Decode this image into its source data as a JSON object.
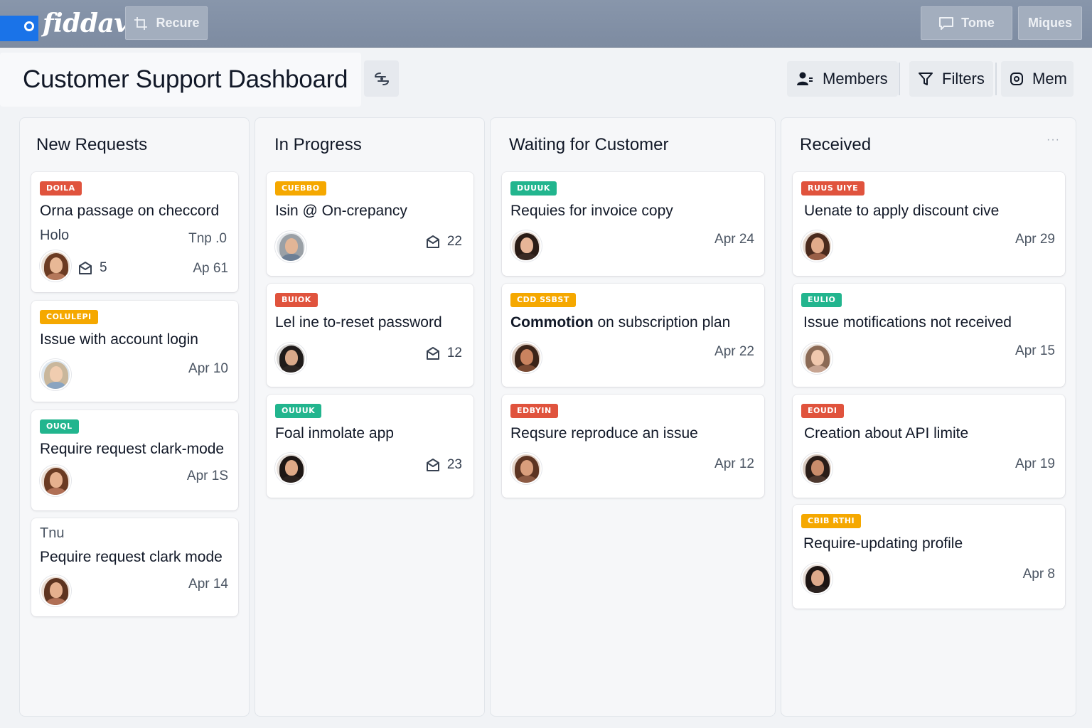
{
  "app": {
    "name": "fiddav",
    "topbar": {
      "left_button": "Recure",
      "right_buttons": [
        "Tome",
        "Miques"
      ]
    }
  },
  "board": {
    "title": "Customer Support Dashboard",
    "actions": [
      "Members",
      "Filters",
      "Mem"
    ]
  },
  "colors": {
    "red": "#e0533d",
    "orange": "#f5a800",
    "green": "#22b58e",
    "topbar": "#8391a6"
  },
  "columns": [
    {
      "title": "New Requests",
      "cards": [
        {
          "tag": "DOILA",
          "tag_color": "red",
          "title": "Orna passage on checcord",
          "sub": "Holo",
          "aux": "Tnp .0",
          "count": "5",
          "date": "Ap 61",
          "avatar": "woman-brown-hair"
        },
        {
          "tag": "COLULEPI",
          "tag_color": "orange",
          "title": "Issue with account login",
          "date": "Apr 10",
          "avatar": "person-light-hair"
        },
        {
          "tag": "OUQL",
          "tag_color": "green",
          "title": "Require request clark-mode",
          "date": "Apr 1S",
          "avatar": "woman-brown-hair"
        },
        {
          "tag": "Tnu",
          "tag_color": "none",
          "title": "Pequire request clark mode",
          "date": "Apr 14",
          "avatar": "woman-brown-hair"
        }
      ]
    },
    {
      "title": "In Progress",
      "cards": [
        {
          "tag": "CUEBBO",
          "tag_color": "orange",
          "title": "Isin @ On-crepancy",
          "count": "22",
          "avatar": "man-gray"
        },
        {
          "tag": "BUIOK",
          "tag_color": "red",
          "title": "Lel ine to-reset password",
          "count": "12",
          "avatar": "woman-dark-hair"
        },
        {
          "tag": "OUUUK",
          "tag_color": "green",
          "title": "Foal inmolate app",
          "count": "23",
          "avatar": "woman-dark-hair"
        }
      ]
    },
    {
      "title": "Waiting for Customer",
      "cards": [
        {
          "tag": "DUUUK",
          "tag_color": "green",
          "title": "Requies for invoice copy",
          "date": "Apr 24",
          "avatar": "woman-dark-hair"
        },
        {
          "tag": "CDD SSBST",
          "tag_color": "orange",
          "title_bold": "Commotion",
          "title": " on subscription plan",
          "date": "Apr 22",
          "avatar": "man-brown"
        },
        {
          "tag": "EDBYIN",
          "tag_color": "red",
          "title": "Reqsure reproduce an issue",
          "date": "Apr 12",
          "avatar": "woman-brown-hair"
        }
      ]
    },
    {
      "title": "Received",
      "more": "···",
      "cards": [
        {
          "tag": "RUUS UIYE",
          "tag_color": "red",
          "title": "Uenate to apply discount cive",
          "date": "Apr 29",
          "avatar": "woman-brown-hair"
        },
        {
          "tag": "EULIO",
          "tag_color": "green",
          "title": "Issue motifications not received",
          "date": "Apr 15",
          "avatar": "woman-light"
        },
        {
          "tag": "EOUDI",
          "tag_color": "red",
          "title": "Creation about API limite",
          "date": "Apr 19",
          "avatar": "woman-dark-hair"
        },
        {
          "tag": "CBIB RTHI",
          "tag_color": "orange",
          "title": "Require-updating profile",
          "date": "Apr 8",
          "avatar": "woman-dark-hair"
        }
      ]
    }
  ]
}
